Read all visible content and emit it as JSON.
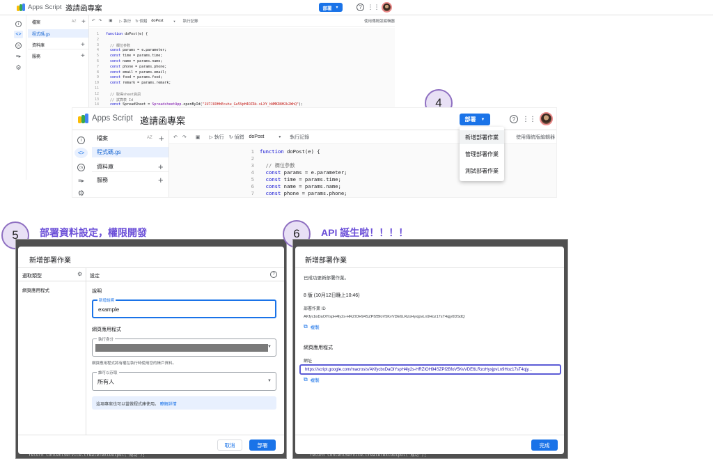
{
  "editor": {
    "app_name": "Apps Script",
    "project_title": "邀請函專案",
    "deploy_label": "部署",
    "files_header": "檔案",
    "file_sort": "AZ",
    "file_name": "程式碼.gs",
    "libraries": "資料庫",
    "services": "服務",
    "run": "執行",
    "debug": "偵錯",
    "function_name": "doPost",
    "execution_log": "執行記錄",
    "legacy_editor": "使用傳統版編輯器",
    "code_lines": [
      "function doPost(e) {",
      "",
      "  // 欄位參數",
      "  const params = e.parameter;",
      "  const time = params.time;",
      "  const name = params.name;",
      "  const phone = params.phone;",
      "  const email = params.email;",
      "  const food = params.food;",
      "  const remark = params.remark;",
      "",
      "  // 取得sheet資訊",
      "  // 試算表 Id",
      "  const SpreadSheet = SpreadsheetApp.openById(\"1U7JUXHhEcuhu_Gu5VpH4OZRk-xLXY_bNMKR8H2k2WhQ\");"
    ]
  },
  "step4": {
    "number": "4",
    "menu": [
      "新增部署作業",
      "管理部署作業",
      "測試部署作業"
    ]
  },
  "step5": {
    "number": "5",
    "heading": "部署資料設定，權限開發",
    "dialog_title": "新增部署作業",
    "select_type": "選取類型",
    "web_app_type": "網頁應用程式",
    "settings": "設定",
    "description_section": "說明",
    "description_label": "新增說明",
    "description_value": "example",
    "web_app_section": "網頁應用程式",
    "execute_as_label": "執行身分",
    "execute_as_hint": "網頁應用程式將有權在執行時使用您的帳戶資料。",
    "access_label": "誰可以存取",
    "access_value": "所有人",
    "info_text": "這項專案也可以當做程式庫使用。",
    "info_link": "瞭解詳情",
    "cancel": "取消",
    "deploy": "部署"
  },
  "step6": {
    "number": "6",
    "heading": "API 誕生啦！！！！",
    "dialog_title": "新增部署作業",
    "success": "已成功更新部署作業。",
    "version": "8 版 (10月12日晚上10:46)",
    "deploy_id_label": "部署作業 ID",
    "deploy_id": "AKfycbxDaOlYspH4ly2s-HRZIOH94SZPf2BfoV5KvVDE6LRzoHyxjpvLn9Hoz17sT4qjy0DSdQ",
    "copy": "複製",
    "web_app_section": "網頁應用程式",
    "url_label": "網址",
    "url": "https://script.google.com/macros/s/AKfycbxDaOlYspH4ly2s-HRZIOH94SZPf2BfoV5KvVDE6LRzoHyxjpvLn9Hoz17sT4qjy...",
    "done": "完成"
  },
  "bottom_code": "return ContentService.createTextOutput(\"成功\");",
  "colors": {
    "accent": "#1a73e8",
    "step_circle": "#e8e0f5",
    "heading": "#6b4fd8"
  }
}
